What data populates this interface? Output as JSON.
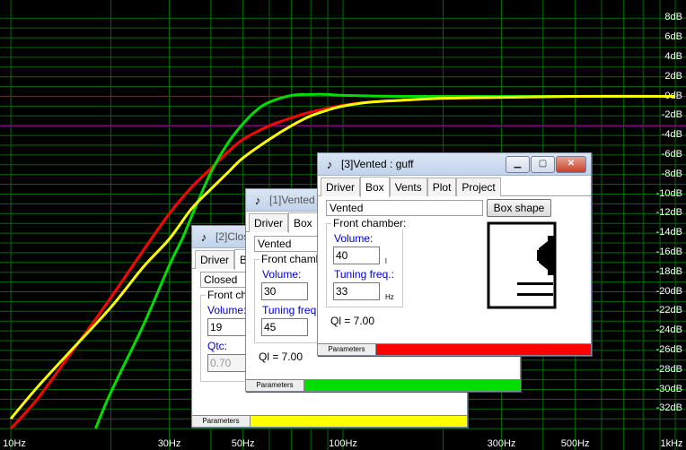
{
  "chart_data": {
    "type": "line",
    "x_scale": "log",
    "xlim": [
      10,
      1000
    ],
    "ylim": [
      -34,
      8
    ],
    "grid": true,
    "x_ticks": [
      {
        "value": 10,
        "label": "10Hz"
      },
      {
        "value": 30,
        "label": "30Hz"
      },
      {
        "value": 50,
        "label": "50Hz"
      },
      {
        "value": 100,
        "label": "100Hz"
      },
      {
        "value": 300,
        "label": "300Hz"
      },
      {
        "value": 500,
        "label": "500Hz"
      },
      {
        "value": 1000,
        "label": "1kHz"
      }
    ],
    "y_ticks": [
      {
        "value": 8,
        "label": "8dB"
      },
      {
        "value": 6,
        "label": "6dB"
      },
      {
        "value": 4,
        "label": "4dB"
      },
      {
        "value": 2,
        "label": "2dB"
      },
      {
        "value": 0,
        "label": "0dB"
      },
      {
        "value": -2,
        "label": "-2dB"
      },
      {
        "value": -4,
        "label": "-4dB"
      },
      {
        "value": -6,
        "label": "-6dB"
      },
      {
        "value": -8,
        "label": "-8dB"
      },
      {
        "value": -10,
        "label": "-10dB"
      },
      {
        "value": -12,
        "label": "-12dB"
      },
      {
        "value": -14,
        "label": "-14dB"
      },
      {
        "value": -16,
        "label": "-16dB"
      },
      {
        "value": -18,
        "label": "-18dB"
      },
      {
        "value": -20,
        "label": "-20dB"
      },
      {
        "value": -22,
        "label": "-22dB"
      },
      {
        "value": -24,
        "label": "-24dB"
      },
      {
        "value": -26,
        "label": "-26dB"
      },
      {
        "value": -28,
        "label": "-28dB"
      },
      {
        "value": -30,
        "label": "-30dB"
      },
      {
        "value": -32,
        "label": "-32dB"
      }
    ],
    "reference_lines": [
      {
        "value": 0,
        "color": "#c00000"
      },
      {
        "value": -3,
        "color": "#a000a0"
      }
    ],
    "series": [
      {
        "color": "#ff0000",
        "x": [
          10,
          12,
          15,
          18,
          20,
          25,
          30,
          35,
          40,
          45,
          50,
          60,
          70,
          80,
          100,
          120,
          150,
          200,
          300,
          500,
          1000
        ],
        "y": [
          -34,
          -31,
          -26.5,
          -22.8,
          -20.6,
          -15.8,
          -12,
          -9.3,
          -7.4,
          -5.7,
          -4.4,
          -3,
          -2.2,
          -1.6,
          -0.9,
          -0.6,
          -0.4,
          -0.2,
          -0.1,
          0,
          0
        ]
      },
      {
        "color": "#00dd00",
        "x": [
          18,
          20,
          25,
          30,
          33,
          35,
          40,
          45,
          50,
          55,
          60,
          70,
          80,
          90,
          100,
          150,
          300,
          1000
        ],
        "y": [
          -34,
          -30.3,
          -23.5,
          -17.3,
          -14.4,
          -12.3,
          -7.8,
          -4.8,
          -2.8,
          -1.4,
          -0.6,
          0.1,
          0.2,
          0.2,
          0.1,
          0,
          0,
          0
        ]
      },
      {
        "color": "#ffff00",
        "x": [
          10,
          12,
          15,
          20,
          25,
          30,
          35,
          40,
          45,
          50,
          60,
          70,
          80,
          90,
          100,
          120,
          150,
          200,
          300,
          500,
          1000
        ],
        "y": [
          -33,
          -29.8,
          -26.2,
          -21.6,
          -17.5,
          -14.6,
          -11.5,
          -9.5,
          -7.8,
          -6.3,
          -4.4,
          -3,
          -2,
          -1.4,
          -1,
          -0.6,
          -0.4,
          -0.2,
          -0.1,
          0,
          0
        ]
      }
    ]
  },
  "windows": {
    "w2": {
      "title": "[2]Clos",
      "tabs": [
        "Driver",
        "Bo"
      ],
      "box_type": "Closed",
      "group_label": "Front cha",
      "volume_label": "Volume:",
      "volume_value": "19",
      "qtc_label": "Qtc:",
      "qtc_value": "0.70",
      "status_label": "Parameters",
      "status_color": "#ffff00"
    },
    "w1": {
      "title": "[1]Vented",
      "tabs": [
        "Driver",
        "Box"
      ],
      "box_type": "Vented",
      "group_label": "Front chamb",
      "volume_label": "Volume:",
      "volume_value": "30",
      "tuning_label": "Tuning freq.:",
      "tuning_value": "45",
      "ql": "Ql = 7.00",
      "status_label": "Parameters",
      "status_color": "#00dd00"
    },
    "w3": {
      "title": "[3]Vented : guff",
      "tabs": [
        "Driver",
        "Box",
        "Vents",
        "Plot",
        "Project"
      ],
      "box_type": "Vented",
      "box_shape_button": "Box shape",
      "group_label": "Front chamber:",
      "volume_label": "Volume:",
      "volume_value": "40",
      "volume_unit": "l",
      "tuning_label": "Tuning freq.:",
      "tuning_value": "33",
      "tuning_unit": "Hz",
      "ql": "Ql = 7.00",
      "status_label": "Parameters",
      "status_color": "#ff0000",
      "minimize_glyph": "▁",
      "maximize_glyph": "▢",
      "close_glyph": "✕"
    }
  }
}
